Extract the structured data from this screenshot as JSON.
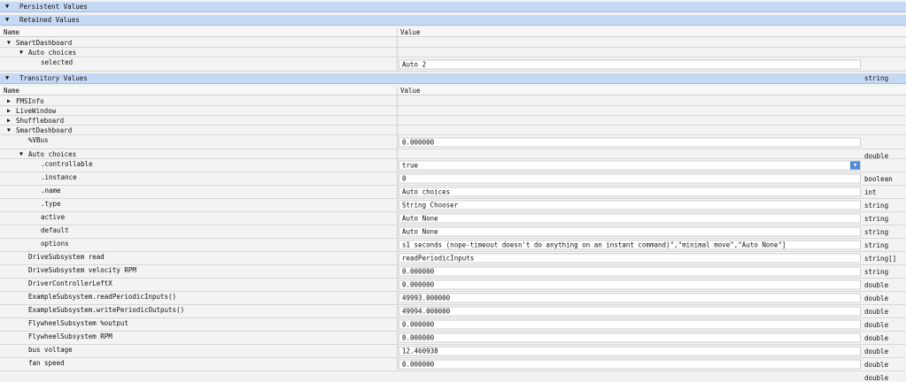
{
  "sections": {
    "persistent": "Persistent Values",
    "retained": "Retained Values",
    "transitory": "Transitory Values"
  },
  "columns": {
    "name": "Name",
    "value": "Value"
  },
  "retained_rows": [
    {
      "name": "SmartDashboard",
      "toggle": "▼",
      "value": "",
      "type": ""
    },
    {
      "name": "Auto choices",
      "toggle": "▼",
      "value": "",
      "type": ""
    },
    {
      "name": "selected",
      "toggle": "",
      "value": "Auto 2",
      "type": "string"
    }
  ],
  "transitory_rows": [
    {
      "name": "FMSInfo",
      "toggle": "▶",
      "value": "",
      "type": ""
    },
    {
      "name": "LiveWindow",
      "toggle": "▶",
      "value": "",
      "type": ""
    },
    {
      "name": "Shuffleboard",
      "toggle": "▶",
      "value": "",
      "type": ""
    },
    {
      "name": "SmartDashboard",
      "toggle": "▼",
      "value": "",
      "type": ""
    },
    {
      "name": "%VBus",
      "toggle": "",
      "value": "0.000000",
      "type": "double"
    },
    {
      "name": "Auto choices",
      "toggle": "▼",
      "value": "",
      "type": ""
    },
    {
      "name": ".controllable",
      "toggle": "",
      "value": "true",
      "type": "boolean"
    },
    {
      "name": ".instance",
      "toggle": "",
      "value": "0",
      "type": "int"
    },
    {
      "name": ".name",
      "toggle": "",
      "value": "Auto choices",
      "type": "string"
    },
    {
      "name": ".type",
      "toggle": "",
      "value": "String Chooser",
      "type": "string"
    },
    {
      "name": "active",
      "toggle": "",
      "value": "Auto None",
      "type": "string"
    },
    {
      "name": "default",
      "toggle": "",
      "value": "Auto None",
      "type": "string"
    },
    {
      "name": "options",
      "toggle": "",
      "value": "s1 seconds (nope-timeout doesn't do anything on an instant command)\",\"minimal move\",\"Auto None\"]",
      "type": "string[]"
    },
    {
      "name": "DriveSubsystem read",
      "toggle": "",
      "value": "readPeriodicInputs",
      "type": "string"
    },
    {
      "name": "DriveSubsystem velocity RPM",
      "toggle": "",
      "value": "0.000000",
      "type": "double"
    },
    {
      "name": "DriverControllerLeftX",
      "toggle": "",
      "value": "0.000000",
      "type": "double"
    },
    {
      "name": "ExampleSubsystem.readPeriodicInputs()",
      "toggle": "",
      "value": "49993.000000",
      "type": "double"
    },
    {
      "name": "ExampleSubsystem.writePeriodicOutputs()",
      "toggle": "",
      "value": "49994.000000",
      "type": "double"
    },
    {
      "name": "FlywheelSubsystem %output",
      "toggle": "",
      "value": "0.000000",
      "type": "double"
    },
    {
      "name": "FlywheelSubsystem RPM",
      "toggle": "",
      "value": "0.000000",
      "type": "double"
    },
    {
      "name": "bus voltage",
      "toggle": "",
      "value": "12.460938",
      "type": "double"
    },
    {
      "name": "fan speed",
      "toggle": "",
      "value": "0.000000",
      "type": "double"
    }
  ],
  "icons": {
    "expanded": "▼",
    "collapsed": "▶",
    "dropdown": "▼"
  },
  "colors": {
    "section": "#c6d9f4",
    "highlight": "#f2f20a",
    "dropdown": "#4f8ad8"
  }
}
